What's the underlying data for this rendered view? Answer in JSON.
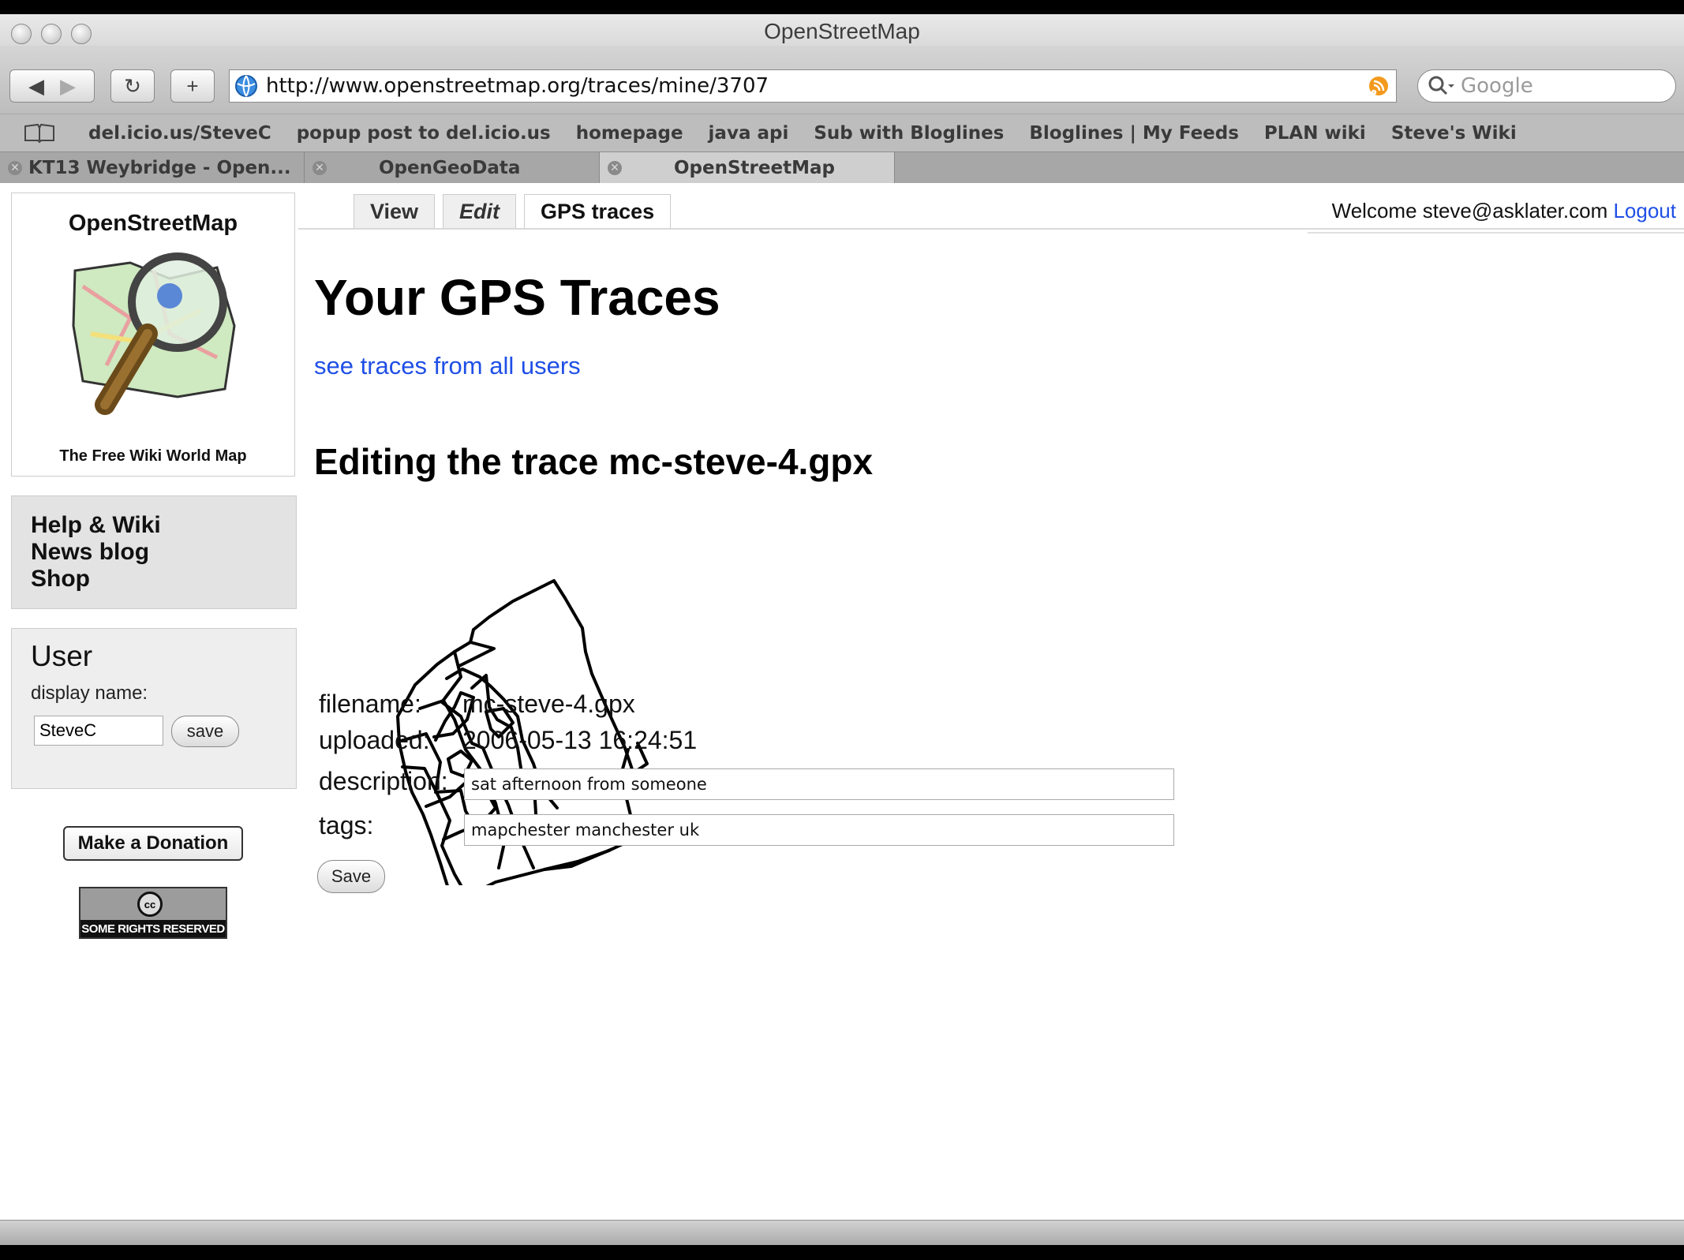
{
  "window": {
    "title": "OpenStreetMap"
  },
  "toolbar": {
    "url": "http://www.openstreetmap.org/traces/mine/3707",
    "search_placeholder": "Google"
  },
  "bookmarks": [
    "del.icio.us/SteveC",
    "popup post to del.icio.us",
    "homepage",
    "java api",
    "Sub with Bloglines",
    "Bloglines | My Feeds",
    "PLAN wiki",
    "Steve's Wiki"
  ],
  "browser_tabs": [
    {
      "label": "KT13 Weybridge - Open..."
    },
    {
      "label": "OpenGeoData"
    },
    {
      "label": "OpenStreetMap"
    }
  ],
  "sidebar": {
    "logo_title": "OpenStreetMap",
    "logo_tagline": "The Free Wiki World Map",
    "links": [
      "Help & Wiki",
      "News blog",
      "Shop"
    ],
    "user_title": "User",
    "display_name_label": "display name:",
    "display_name_value": "SteveC",
    "save_label": "save",
    "donate_label": "Make a Donation",
    "cc_text": "SOME RIGHTS RESERVED",
    "cc_symbol": "cc"
  },
  "page_tabs": [
    {
      "label": "View"
    },
    {
      "label": "Edit"
    },
    {
      "label": "GPS traces"
    }
  ],
  "header": {
    "welcome": "Welcome steve@asklater.com",
    "logout": "Logout"
  },
  "main": {
    "title": "Your GPS Traces",
    "all_users_link": "see traces from all users",
    "subtitle": "Editing the trace mc-steve-4.gpx",
    "form": {
      "filename_label": "filename:",
      "filename_value": "mc-steve-4.gpx",
      "uploaded_label": "uploaded:",
      "uploaded_value": "2006-05-13 16:24:51",
      "description_label": "description:",
      "description_value": "sat afternoon from someone",
      "tags_label": "tags:",
      "tags_value": "mapchester manchester uk",
      "save_label": "Save"
    }
  }
}
